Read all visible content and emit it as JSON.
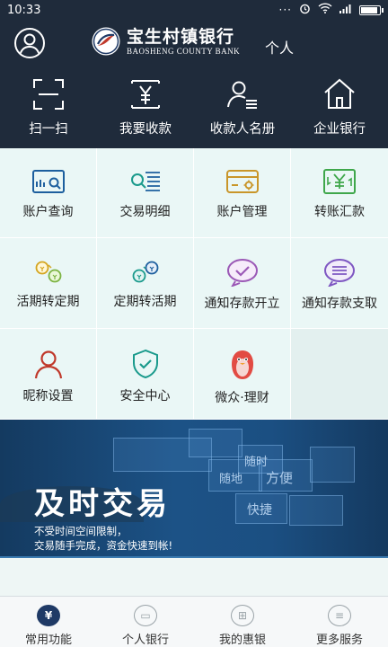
{
  "status_bar": {
    "time": "10:33",
    "dots": "···",
    "battery_level": 0.95
  },
  "header": {
    "bank_name_cn": "宝生村镇银行",
    "bank_name_en": "BAOSHENG COUNTY BANK",
    "personal_label": "个人",
    "quick_actions": [
      {
        "label": "扫一扫",
        "icon": "scan-icon"
      },
      {
        "label": "我要收款",
        "icon": "receive-money-icon"
      },
      {
        "label": "收款人名册",
        "icon": "payee-list-icon"
      },
      {
        "label": "企业银行",
        "icon": "corporate-bank-icon"
      }
    ]
  },
  "functions": [
    {
      "label": "账户查询",
      "icon": "account-query-icon"
    },
    {
      "label": "交易明细",
      "icon": "transaction-detail-icon"
    },
    {
      "label": "账户管理",
      "icon": "account-manage-icon"
    },
    {
      "label": "转账汇款",
      "icon": "transfer-icon"
    },
    {
      "label": "活期转定期",
      "icon": "current-to-fixed-icon"
    },
    {
      "label": "定期转活期",
      "icon": "fixed-to-current-icon"
    },
    {
      "label": "通知存款开立",
      "icon": "notice-deposit-open-icon"
    },
    {
      "label": "通知存款支取",
      "icon": "notice-deposit-withdraw-icon"
    },
    {
      "label": "昵称设置",
      "icon": "nickname-icon"
    },
    {
      "label": "安全中心",
      "icon": "shield-icon"
    },
    {
      "label": "微众·理财",
      "icon": "penguin-icon"
    }
  ],
  "banner": {
    "title": "及时交易",
    "line1": "不受时间空间限制，",
    "line2": "交易随手完成，资金快速到帐!",
    "tile_words": [
      "随时",
      "随地",
      "方便",
      "快捷"
    ]
  },
  "tabbar": [
    {
      "label": "常用功能",
      "glyph": "¥",
      "icon": "yuan-icon",
      "active": true
    },
    {
      "label": "个人银行",
      "glyph": "▭",
      "icon": "personal-bank-icon",
      "active": false
    },
    {
      "label": "我的惠银",
      "glyph": "⊞",
      "icon": "my-benefits-icon",
      "active": false
    },
    {
      "label": "更多服务",
      "glyph": "≡",
      "icon": "more-services-icon",
      "active": false
    }
  ],
  "colors": {
    "header_bg": "#1f2b3b",
    "grid_bg": "#eaf7f6",
    "tab_active": "#1f3a66"
  }
}
